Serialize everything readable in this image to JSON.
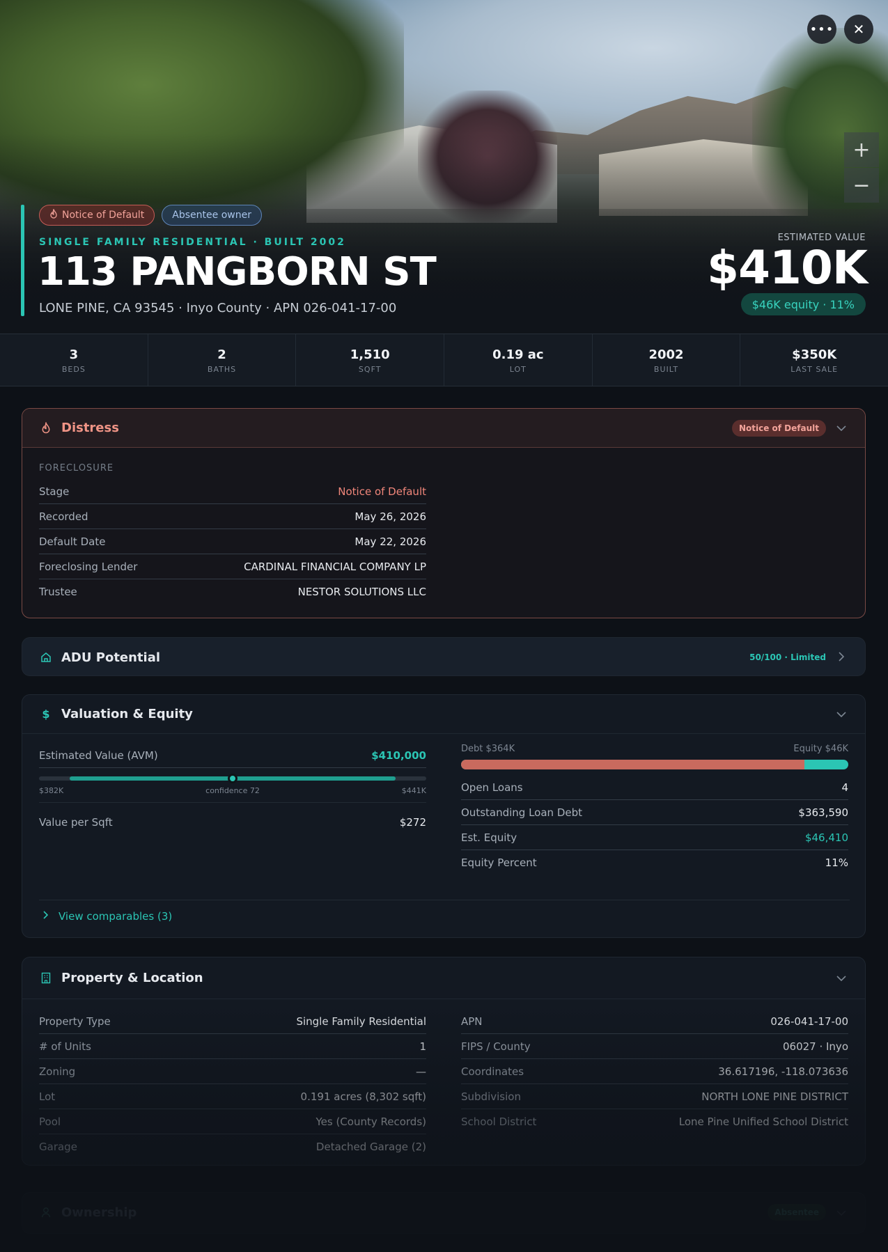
{
  "hero": {
    "badges": {
      "distress": "Notice of Default",
      "owner": "Absentee owner"
    },
    "kicker": "SINGLE FAMILY RESIDENTIAL · BUILT 2002",
    "address": "113 PANGBORN ST",
    "subline": "LONE PINE, CA 93545 · Inyo County · APN 026-041-17-00",
    "est_label": "ESTIMATED VALUE",
    "est_value": "$410K",
    "equity": "$46K equity · 11%",
    "more": "•••",
    "close": "✕",
    "zoom_in": "+",
    "zoom_out": "−"
  },
  "stats": [
    {
      "value": "3",
      "label": "BEDS"
    },
    {
      "value": "2",
      "label": "BATHS"
    },
    {
      "value": "1,510",
      "label": "SQFT"
    },
    {
      "value": "0.19 ac",
      "label": "LOT"
    },
    {
      "value": "2002",
      "label": "BUILT"
    },
    {
      "value": "$350K",
      "label": "LAST SALE"
    }
  ],
  "distress": {
    "title": "Distress",
    "pill": "Notice of Default",
    "section": "FORECLOSURE",
    "rows": [
      {
        "k": "Stage",
        "v": "Notice of Default"
      },
      {
        "k": "Recorded",
        "v": "May 26, 2026"
      },
      {
        "k": "Default Date",
        "v": "May 22, 2026"
      },
      {
        "k": "Foreclosing Lender",
        "v": "CARDINAL FINANCIAL COMPANY LP"
      },
      {
        "k": "Trustee",
        "v": "NESTOR SOLUTIONS LLC"
      }
    ]
  },
  "adu": {
    "title": "ADU Potential",
    "score": "50/100 · Limited"
  },
  "valuation": {
    "title": "Valuation & Equity",
    "avm_label": "Estimated Value (AVM)",
    "avm_value": "$410,000",
    "range_low": "$382K",
    "range_high": "$441K",
    "confidence": "confidence 72",
    "range_fill_start": 0.08,
    "range_fill_end": 0.92,
    "range_marker": 0.5,
    "vps_label": "Value per Sqft",
    "vps_value": "$272",
    "debt_label": "Debt $364K",
    "equity_label": "Equity $46K",
    "debt_fraction": 0.887,
    "rows": [
      {
        "k": "Open Loans",
        "v": "4"
      },
      {
        "k": "Outstanding Loan Debt",
        "v": "$363,590"
      },
      {
        "k": "Est. Equity",
        "v": "$46,410"
      },
      {
        "k": "Equity Percent",
        "v": "11%"
      }
    ],
    "comps": "View comparables (3)"
  },
  "property": {
    "title": "Property & Location",
    "left": [
      {
        "k": "Property Type",
        "v": "Single Family Residential"
      },
      {
        "k": "# of Units",
        "v": "1"
      },
      {
        "k": "Zoning",
        "v": "—"
      },
      {
        "k": "Lot",
        "v": "0.191 acres (8,302 sqft)"
      },
      {
        "k": "Pool",
        "v": "Yes (County Records)"
      },
      {
        "k": "Garage",
        "v": "Detached Garage (2)"
      }
    ],
    "right": [
      {
        "k": "APN",
        "v": "026-041-17-00"
      },
      {
        "k": "FIPS / County",
        "v": "06027 · Inyo"
      },
      {
        "k": "Coordinates",
        "v": "36.617196, -118.073636"
      },
      {
        "k": "Subdivision",
        "v": "NORTH LONE PINE DISTRICT"
      },
      {
        "k": "School District",
        "v": "Lone Pine Unified School District"
      }
    ]
  },
  "ownership": {
    "title": "Ownership",
    "pill": "Absentee"
  },
  "colors": {
    "accent": "#2bc5b4",
    "distress": "#f0867a",
    "background": "#0d1117"
  }
}
